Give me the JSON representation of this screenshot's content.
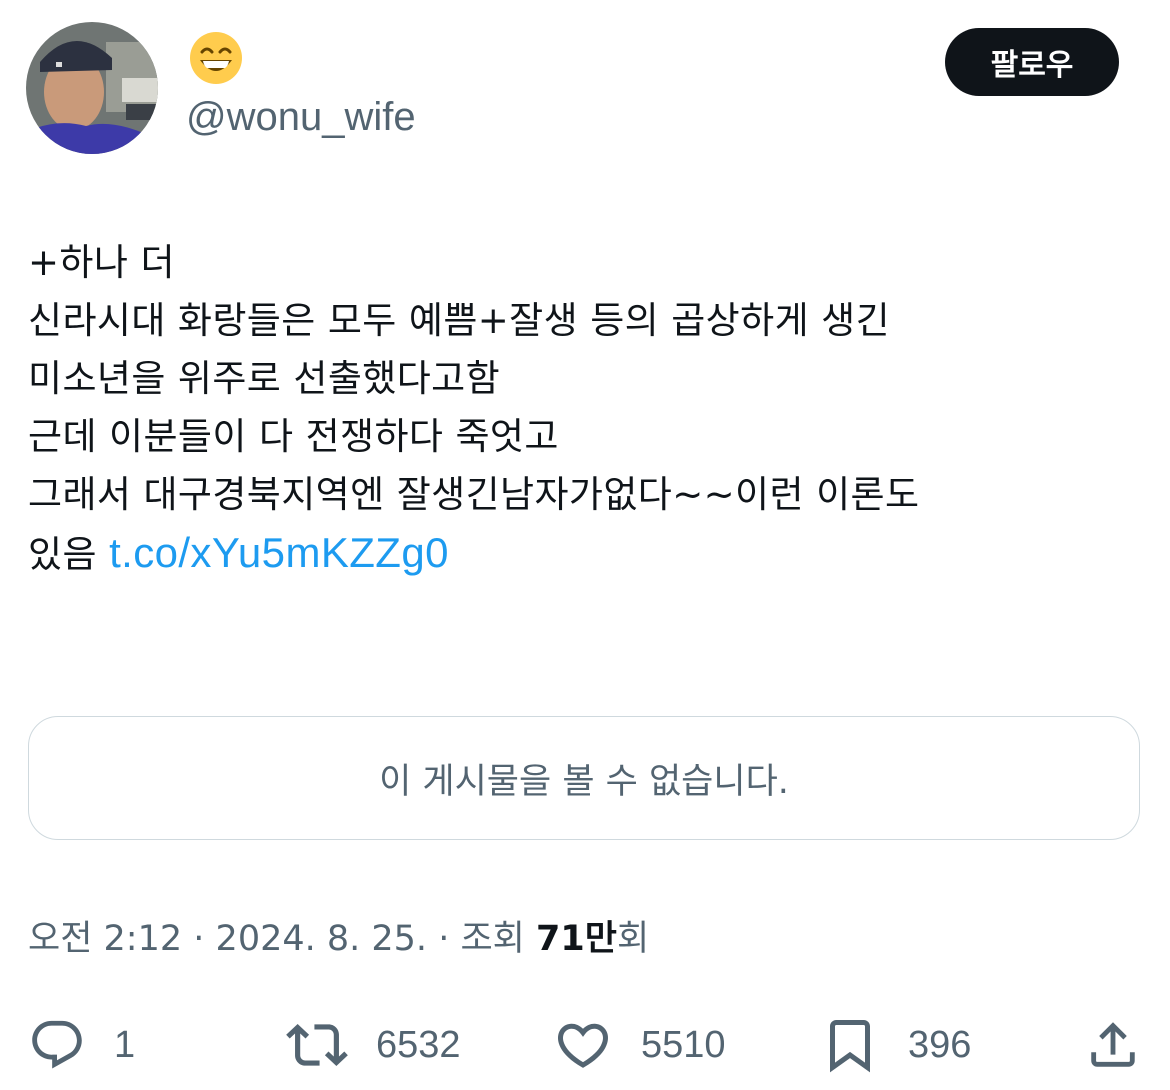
{
  "author": {
    "display_name_emoji": "grinning-face-with-smiling-eyes",
    "handle": "@wonu_wife"
  },
  "follow_button": {
    "label": "팔로우"
  },
  "tweet": {
    "lines": [
      "+하나 더",
      "신라시대 화랑들은 모두 예쁨+잘생 등의 곱상하게 생긴",
      "미소년을 위주로 선출했다고함",
      "근데 이분들이 다 전쟁하다 죽엇고",
      "그래서 대구경북지역엔 잘생긴남자가없다~~이런 이론도"
    ],
    "last_line_prefix": "있음",
    "link_text": "t.co/xYu5mKZZg0"
  },
  "quoted_card": {
    "message": "이 게시물을 볼 수 없습니다."
  },
  "meta": {
    "time": "오전 2:12",
    "separator": "·",
    "date": "2024. 8. 25.",
    "views_label": "조회",
    "views_count": "71만",
    "views_suffix": "회"
  },
  "actions": {
    "replies": "1",
    "retweets": "6532",
    "likes": "5510",
    "bookmarks": "396"
  },
  "colors": {
    "text": "#0f1419",
    "secondary": "#536471",
    "link": "#1d9bf0",
    "border": "#cfd9de",
    "button_bg": "#0f1419"
  }
}
